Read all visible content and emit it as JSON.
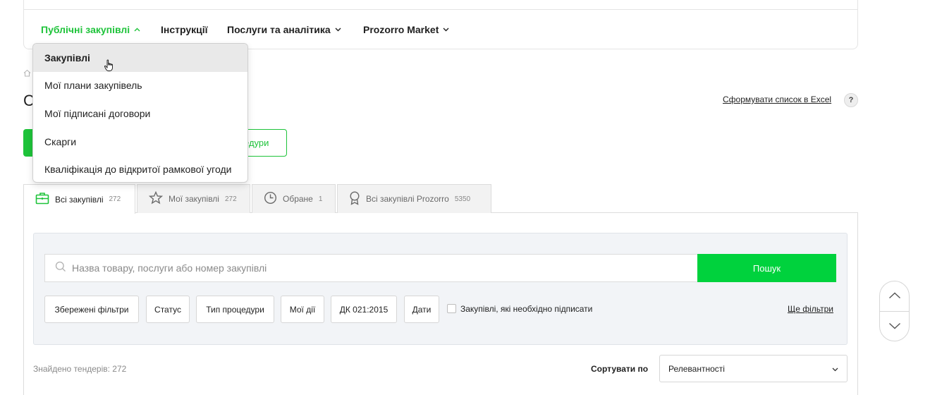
{
  "nav": {
    "items": [
      {
        "label": "Публічні закупівлі",
        "chevron": "^"
      },
      {
        "label": "Інструкції"
      },
      {
        "label": "Послуги та аналітика",
        "chevron": "v"
      },
      {
        "label": "Prozorro Market",
        "chevron": "v"
      }
    ],
    "dropdown": [
      "Закупівлі",
      "Мої плани закупівель",
      "Мої підписані договори",
      "Скарги",
      "Кваліфікація до відкритої рамкової угоди"
    ]
  },
  "page": {
    "title_fragment": "С",
    "excel_link": "Сформувати список в Excel",
    "help": "?",
    "procedures_button_fragment": "едури"
  },
  "tabs": [
    {
      "label": "Всі закупівлі",
      "count": "272",
      "icon": "briefcase-icon"
    },
    {
      "label": "Мої закупівлі",
      "count": "272",
      "icon": "star-icon"
    },
    {
      "label": "Обране",
      "count": "1",
      "icon": "clock-icon"
    },
    {
      "label": "Всі закупівлі Prozorro",
      "count": "5350",
      "icon": "award-icon"
    }
  ],
  "search": {
    "placeholder": "Назва товару, послуги або номер закупівлі",
    "button": "Пошук"
  },
  "filters": {
    "buttons": [
      "Збережені фільтри",
      "Статус",
      "Тип процедури",
      "Мої дії",
      "ДК 021:2015",
      "Дати"
    ],
    "checkbox_label": "Закупівлі, які необхідно підписати",
    "more": "Ще фільтри"
  },
  "results": {
    "found": "Знайдено тендерів: 272",
    "sort_label": "Сортувати по",
    "sort_value": "Релевантності"
  },
  "colors": {
    "accent": "#1ec33a",
    "search_button": "#00d23d"
  }
}
